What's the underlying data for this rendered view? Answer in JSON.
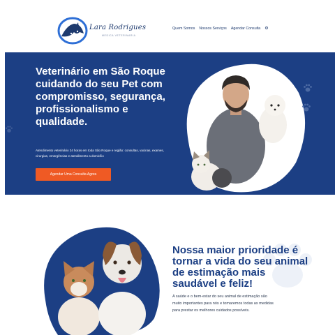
{
  "brand": {
    "name": "Lara Rodrigues",
    "tagline": "MEDICA VETERINARIA"
  },
  "nav": {
    "items": [
      "Quem Somos",
      "Nossos Serviços",
      "Agendar Consulta"
    ],
    "settings_icon": "gear-icon"
  },
  "hero": {
    "title": "Veterinário em São Roque cuidando do seu Pet com compromisso, segurança, profissionalismo e qualidade.",
    "description": "Atendimento veterinário 24 horas em toda São Roque e região: consultas, vacinas, exames, cirurgias, emergências e atendimento a domicílio",
    "cta_label": "Agendar Uma Consulta Agora",
    "colors": {
      "background": "#1c3f84",
      "button": "#ef5a24"
    }
  },
  "section2": {
    "title": "Nossa maior prioridade é tornar a vida do seu animal de estimação mais saudável e feliz!",
    "text": "A saúde e o bem-estar do seu animal de estimação são muito importantes para nós e tomaremos todas as medidas para prestar os melhores cuidados possíveis."
  }
}
